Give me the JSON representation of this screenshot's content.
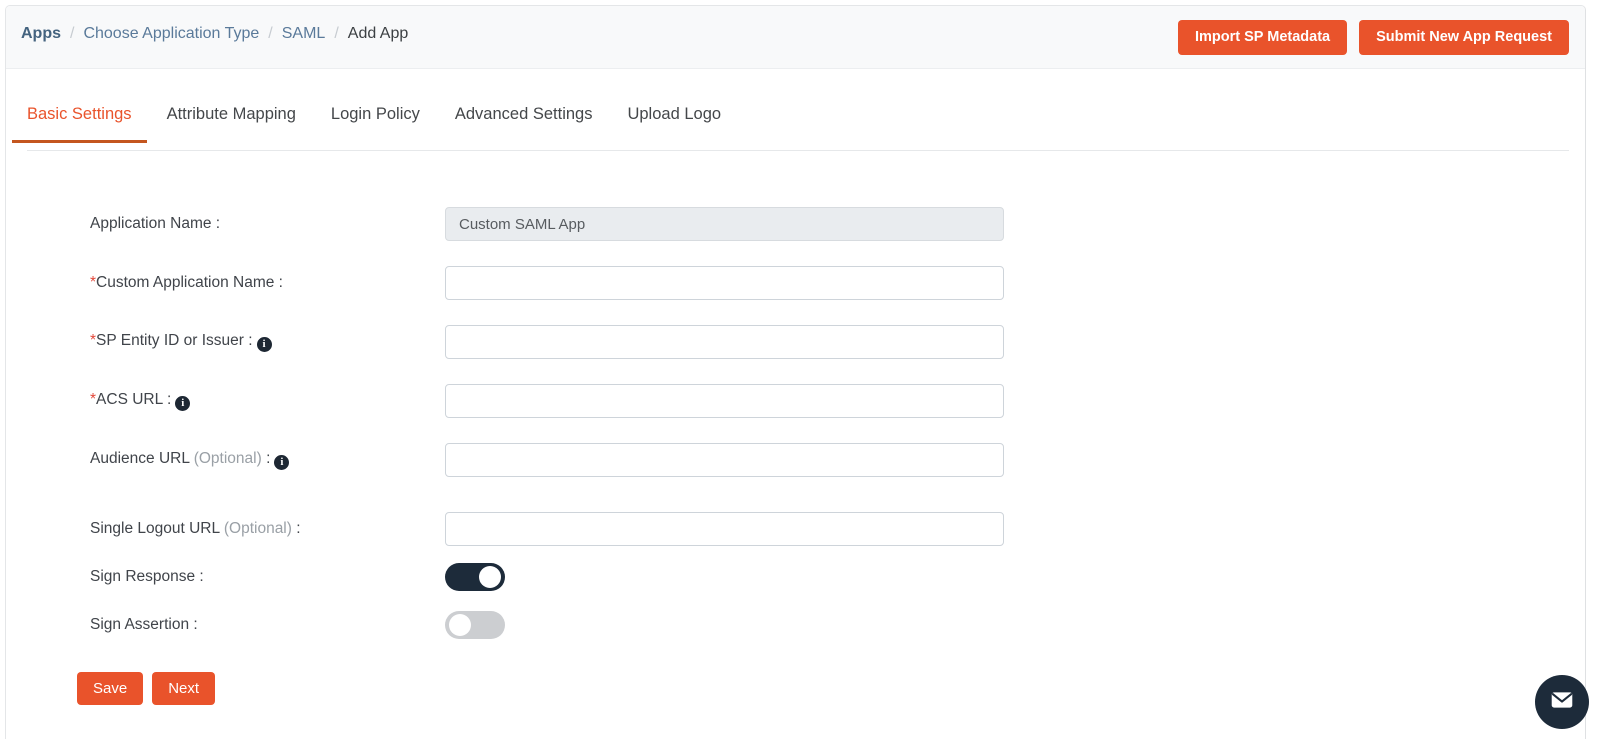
{
  "header": {
    "breadcrumb": [
      {
        "label": "Apps",
        "type": "link"
      },
      {
        "label": "Choose Application Type",
        "type": "link"
      },
      {
        "label": "SAML",
        "type": "link"
      },
      {
        "label": "Add App",
        "type": "current"
      }
    ],
    "separator": "/",
    "actions": {
      "import_sp_metadata": "Import SP Metadata",
      "submit_new_app_request": "Submit New App Request"
    }
  },
  "tabs": [
    {
      "label": "Basic Settings",
      "active": true
    },
    {
      "label": "Attribute Mapping",
      "active": false
    },
    {
      "label": "Login Policy",
      "active": false
    },
    {
      "label": "Advanced Settings",
      "active": false
    },
    {
      "label": "Upload Logo",
      "active": false
    }
  ],
  "form": {
    "application_name": {
      "label": "Application Name :",
      "value": "Custom SAML App",
      "placeholder": "",
      "disabled": true
    },
    "custom_application_name": {
      "required_mark": "*",
      "label": "Custom Application Name :",
      "value": "",
      "placeholder": ""
    },
    "sp_entity_id": {
      "required_mark": "*",
      "label": "SP Entity ID or Issuer :",
      "info_icon": "info-icon",
      "value": "",
      "placeholder": ""
    },
    "acs_url": {
      "required_mark": "*",
      "label": "ACS URL :",
      "info_icon": "info-icon",
      "value": "",
      "placeholder": ""
    },
    "audience_url": {
      "label": "Audience URL",
      "optional": "(Optional)",
      "colon": ":",
      "info_icon": "info-icon",
      "value": "",
      "placeholder": ""
    },
    "single_logout_url": {
      "label": "Single Logout URL",
      "optional": "(Optional)",
      "colon": ":",
      "value": "",
      "placeholder": ""
    },
    "sign_response": {
      "label": "Sign Response :",
      "state": "on"
    },
    "sign_assertion": {
      "label": "Sign Assertion :",
      "state": "off"
    }
  },
  "footer": {
    "save_label": "Save",
    "next_label": "Next"
  },
  "chat": {
    "icon": "envelope-icon"
  },
  "colors": {
    "accent_orange": "#e9532b",
    "tab_underline": "#c4561f",
    "toggle_on": "#1d2b3a",
    "toggle_off": "#ccced1",
    "required_red": "#e3483a",
    "breadcrumb_link": "#5a7a9a",
    "header_bg": "#f8f9fa"
  }
}
